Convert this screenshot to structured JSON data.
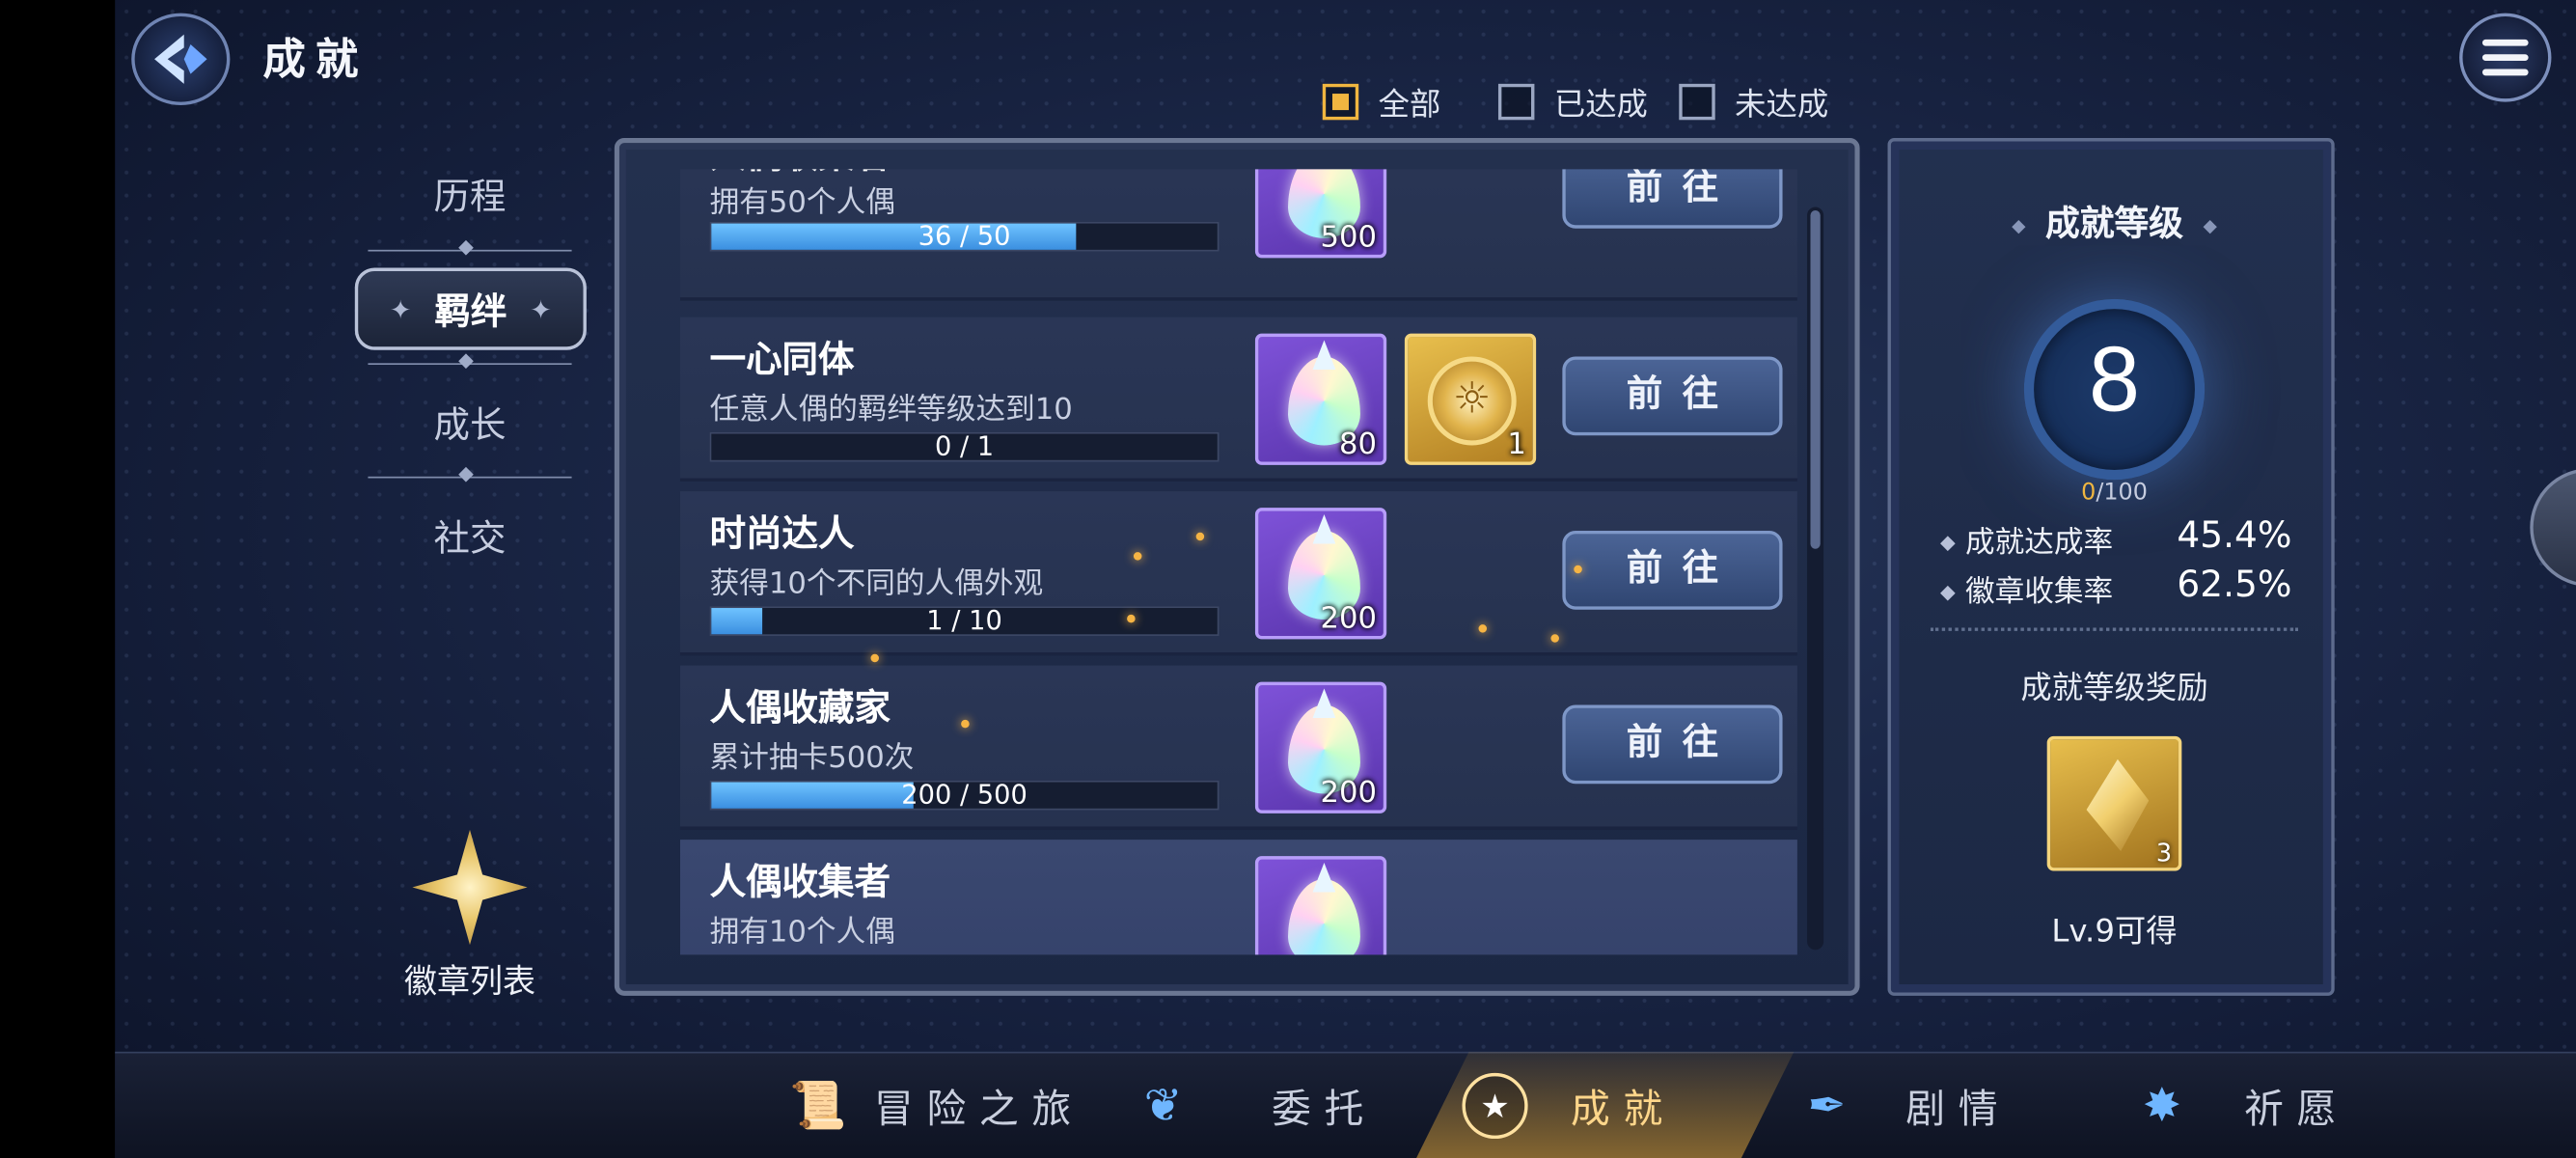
{
  "header": {
    "title": "成就"
  },
  "filters": [
    {
      "label": "全部",
      "checked": true
    },
    {
      "label": "已达成",
      "checked": false
    },
    {
      "label": "未达成",
      "checked": false
    }
  ],
  "nav": {
    "items": [
      "历程",
      "羁绊",
      "成长",
      "社交"
    ],
    "active": "羁绊"
  },
  "badge_list": {
    "label": "徽章列表"
  },
  "achievements": [
    {
      "title": "人偶收集者",
      "desc": "拥有50个人偶",
      "progress_text": "36 / 50",
      "progress": 0.72,
      "rewards": [
        {
          "type": "gem",
          "count": "500"
        }
      ],
      "button": "前往"
    },
    {
      "title": "一心同体",
      "desc": "任意人偶的羁绊等级达到10",
      "progress_text": "0 / 1",
      "progress": 0.0,
      "rewards": [
        {
          "type": "gem",
          "count": "80"
        },
        {
          "type": "coin",
          "count": "1"
        }
      ],
      "button": "前往"
    },
    {
      "title": "时尚达人",
      "desc": "获得10个不同的人偶外观",
      "progress_text": "1 / 10",
      "progress": 0.1,
      "rewards": [
        {
          "type": "gem",
          "count": "200"
        }
      ],
      "button": "前往"
    },
    {
      "title": "人偶收藏家",
      "desc": "累计抽卡500次",
      "progress_text": "200 / 500",
      "progress": 0.4,
      "rewards": [
        {
          "type": "gem",
          "count": "200"
        }
      ],
      "button": "前往"
    },
    {
      "title": "人偶收集者",
      "desc": "拥有10个人偶",
      "progress_text": "",
      "progress": null,
      "rewards": [
        {
          "type": "gem",
          "count": ""
        }
      ],
      "button": ""
    }
  ],
  "summary": {
    "title": "成就等级",
    "level": "8",
    "progress_current": "0",
    "progress_total": "/100",
    "stats": [
      {
        "label": "成就达成率",
        "value": "45.4%"
      },
      {
        "label": "徽章收集率",
        "value": "62.5%"
      }
    ],
    "reward_title": "成就等级奖励",
    "reward_count": "3",
    "reward_condition": "Lv.9可得"
  },
  "bottom_nav": [
    {
      "label": "冒险之旅",
      "icon": "scroll-icon"
    },
    {
      "label": "委托",
      "icon": "feather-icon"
    },
    {
      "label": "成就",
      "icon": "medal-icon",
      "active": true
    },
    {
      "label": "剧情",
      "icon": "quill-icon"
    },
    {
      "label": "祈愿",
      "icon": "star-burst-icon"
    }
  ],
  "colors": {
    "accent_gold": "#f0b640",
    "progress_blue": "#4fa6f0",
    "gem_card_purple": "#6b45c4"
  }
}
